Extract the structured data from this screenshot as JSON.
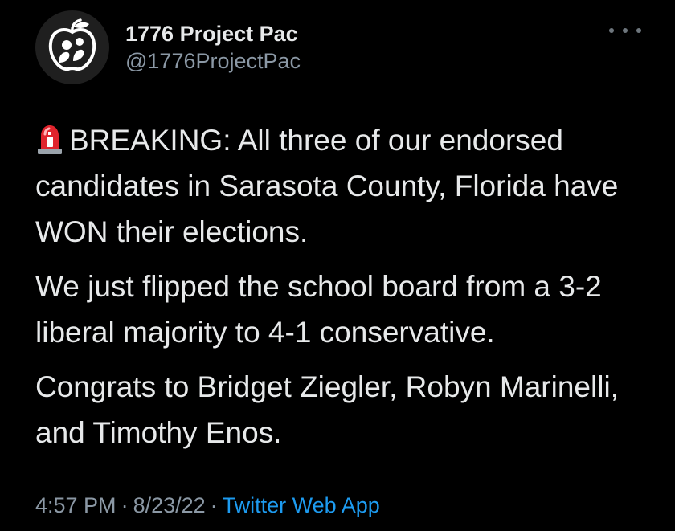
{
  "tweet": {
    "author": {
      "display_name": "1776 Project Pac",
      "handle": "@1776ProjectPac",
      "avatar_icon": "apple-logo-icon"
    },
    "more_icon": "more-options-icon",
    "paragraphs": [
      {
        "emoji": "rotating-light-icon",
        "text": "BREAKING: All three of our endorsed candidates in Sarasota County, Florida have WON their elections."
      },
      {
        "text": "We just flipped the school board from a 3-2 liberal majority to 4-1 conservative."
      },
      {
        "text": "Congrats to Bridget Ziegler, Robyn Marinelli, and Timothy Enos."
      }
    ],
    "meta": {
      "time": "4:57 PM",
      "separator": "·",
      "date": "8/23/22",
      "source": "Twitter Web App"
    }
  },
  "colors": {
    "background": "#000000",
    "text": "#e7e9ea",
    "muted": "#8b98a5",
    "link": "#1d9bf0"
  }
}
